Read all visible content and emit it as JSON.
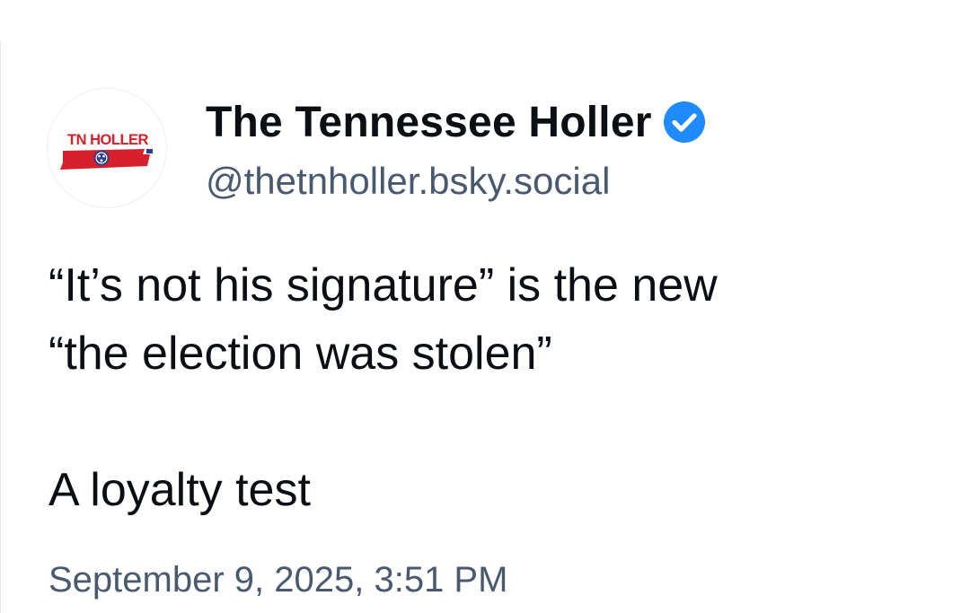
{
  "post": {
    "author": {
      "display_name": "The Tennessee Holler",
      "handle": "@thetnholler.bsky.social",
      "verified": true,
      "avatar_logo_text": "TN HOLLER",
      "avatar_icon": "tennessee-map-logo"
    },
    "text_line_1": "“It’s not his signature” is the new",
    "text_line_2": "“the election was stolen”",
    "text_line_3": "A loyalty test",
    "timestamp": "September 9, 2025, 3:51 PM"
  },
  "colors": {
    "verified_blue": "#208bfe",
    "handle_gray": "#4a5a6e",
    "text_dark": "#0b0f14",
    "logo_red": "#d6202b",
    "logo_blue": "#2d3d8f"
  }
}
